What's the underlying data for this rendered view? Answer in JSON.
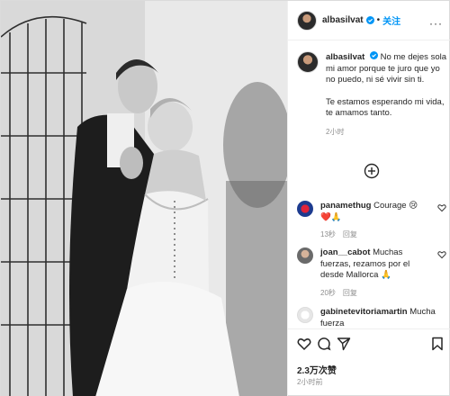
{
  "post": {
    "username": "albasilvat",
    "dot": "•",
    "follow_label": "关注",
    "more_label": "···",
    "caption_p1": "No me dejes sola mi amor porque te juro que yo no puedo, ni sé vivir sin ti.",
    "caption_p2": "Te estamos esperando mi vida, te amamos tanto.",
    "caption_time": "2小时",
    "likes": "2.3万次赞",
    "post_time": "2小时前"
  },
  "comments": [
    {
      "user": "panamethug",
      "text": "Courage 😢❤️🙏",
      "time": "13秒",
      "reply": "回复"
    },
    {
      "user": "joan__cabot",
      "text": "Muchas fuerzas, rezamos por el desde Mallorca 🙏",
      "time": "20秒",
      "reply": "回复"
    },
    {
      "user": "gabinetevitoriamartin",
      "text": "Mucha fuerza",
      "time": "",
      "reply": ""
    }
  ],
  "icons": {
    "verified": "verified-badge-icon",
    "load_more": "plus-circle-icon",
    "like": "heart-icon",
    "comment": "comment-icon",
    "share": "paper-plane-icon",
    "save": "bookmark-icon"
  },
  "colors": {
    "accent": "#0095f6",
    "secondary_text": "#8e8e8e",
    "border": "#dbdbdb"
  }
}
